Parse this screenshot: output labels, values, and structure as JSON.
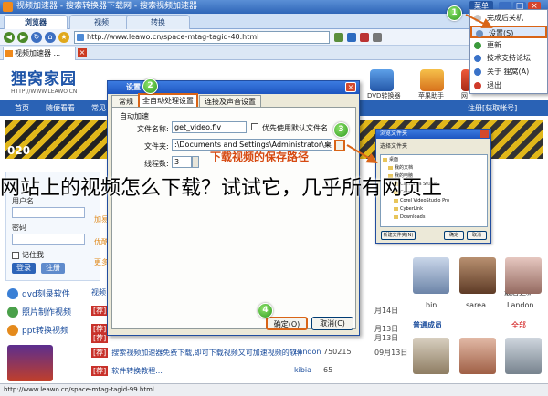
{
  "window": {
    "title": "视频加速器 - 搜索转换器下载网 - 搜索视频加速器",
    "menu_label": "菜单",
    "min": "_",
    "max": "□",
    "close": "×"
  },
  "top_tabs": [
    "浏览器",
    "视频",
    "转换"
  ],
  "address": {
    "url": "http://www.leawo.cn/space-mtag-tagid-40.html"
  },
  "page_tab": {
    "label": "视频加速器 ...",
    "close": "×"
  },
  "site": {
    "logo_main": "狸窝家园",
    "logo_url": "HTTP://WWW.LEAWO.CN",
    "header_items": [
      "DVD转换器",
      "苹果助手",
      "网"
    ],
    "nav": [
      "首页",
      "随便看看",
      "常见"
    ],
    "nav_right": "注册[获取帐号]",
    "banner_text": "020",
    "login_label_user": "用户名",
    "login_label_pass": "密码",
    "remember": "记住我",
    "login_btn": "登录",
    "register_btn": "注册",
    "side_links": [
      "dvd刻录软件",
      "照片制作视频",
      "ppt转换视频"
    ],
    "snippets": [
      "加易",
      "优酷",
      "更多"
    ],
    "news": [
      {
        "tag": "[荐]",
        "title": "视频",
        "date": "月14日"
      },
      {
        "tag": "[荐]",
        "title": "",
        "date": "月13日"
      },
      {
        "tag": "[荐]",
        "title": "",
        "date": "月13日"
      },
      {
        "tag": "[荐]",
        "title": "搜索视频加速器免费下载,即可下载视频又可加速视频的软件",
        "user": "Landon",
        "count": "750215",
        "date": "09月13日"
      },
      {
        "tag": "[荐]",
        "title": "软件转换教程...",
        "user": "kibia",
        "count": "65",
        "date": ""
      }
    ],
    "latest": "最后更新",
    "avatars": [
      "bin",
      "sarea",
      "Landon"
    ],
    "members_title": "普通成员",
    "members_all": "全部"
  },
  "menu": {
    "items": [
      "完成后关机",
      "设置(S)",
      "更新",
      "技术支持论坛",
      "关于 狸窝(A)",
      "退出"
    ]
  },
  "settings_dialog": {
    "title": "设置",
    "tabs": [
      "常规",
      "全自动处理设置",
      "连接及声音设置"
    ],
    "group": "自动加速",
    "filename_label": "文件名称:",
    "filename_value": "get_video.flv",
    "default_name_label": "优先使用默认文件名",
    "folder_label": "文件夹:",
    "folder_value": ":\\Documents and Settings\\Administrator\\桌面\\",
    "threads_label": "线程数:",
    "threads_value": "3",
    "ok": "确定(O)",
    "cancel": "取消(C)"
  },
  "annotation": {
    "save_path_hint": "下载视频的保存路径",
    "caption": "网站上的视频怎么下载？试试它，几乎所有网页上",
    "badges": [
      "1",
      "2",
      "3",
      "4"
    ]
  },
  "browse_dialog": {
    "title": "浏览文件夹",
    "prompt": "选择文件夹",
    "tree": [
      "桌面",
      "我的文档",
      "我的电脑",
      "Camtasia Studio",
      "Corel",
      "Corel VideoStudio Pro",
      "CyberLink",
      "Downloads"
    ],
    "new_folder": "新建文件夹(N)",
    "ok": "确定",
    "cancel": "取消"
  },
  "statusbar": {
    "url": "http://www.leawo.cn/space-mtag-tagid-99.html"
  },
  "colors": {
    "accent_orange": "#d96416",
    "title_blue": "#2f66b8",
    "badge_green": "#2e9a1f"
  }
}
